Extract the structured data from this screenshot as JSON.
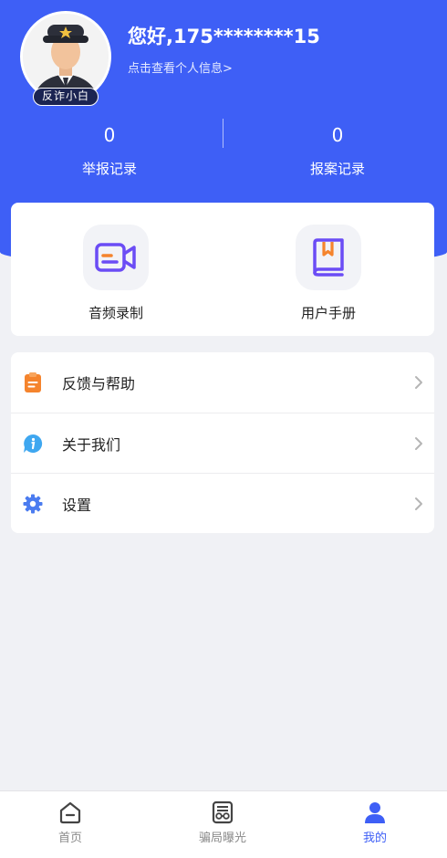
{
  "header": {
    "greeting": "您好,175********15",
    "profile_link": "点击查看个人信息>",
    "avatar_badge": "反诈小白",
    "stats": [
      {
        "value": "0",
        "label": "举报记录"
      },
      {
        "value": "0",
        "label": "报案记录"
      }
    ]
  },
  "tools": [
    {
      "label": "音频录制",
      "icon": "video-record-icon"
    },
    {
      "label": "用户手册",
      "icon": "book-icon"
    }
  ],
  "menu": [
    {
      "label": "反馈与帮助",
      "icon": "clipboard-icon"
    },
    {
      "label": "关于我们",
      "icon": "info-chat-icon"
    },
    {
      "label": "设置",
      "icon": "gear-icon"
    }
  ],
  "tabbar": [
    {
      "label": "首页",
      "icon": "home-icon",
      "active": false
    },
    {
      "label": "骗局曝光",
      "icon": "glasses-document-icon",
      "active": false
    },
    {
      "label": "我的",
      "icon": "user-icon",
      "active": true
    }
  ],
  "colors": {
    "brand": "#3e5ff6",
    "background": "#f0f1f5",
    "tool_accent_purple": "#6b4cf5",
    "tool_accent_orange": "#f5842d"
  }
}
